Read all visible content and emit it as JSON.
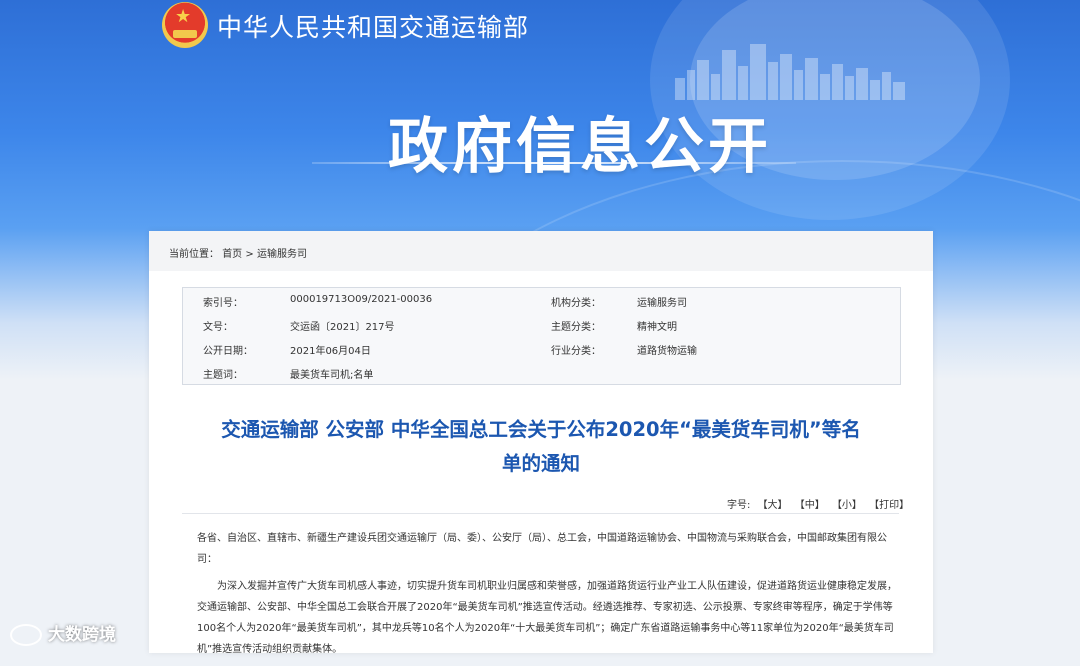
{
  "header": {
    "ministry_name": "中华人民共和国交通运输部",
    "page_title": "政府信息公开"
  },
  "breadcrumb": {
    "prefix": "当前位置：",
    "home": "首页",
    "separator": ">",
    "current": "运输服务司"
  },
  "meta": {
    "index_label": "索引号：",
    "index_value": "000019713O09/2021-00036",
    "org_label": "机构分类：",
    "org_value": "运输服务司",
    "docno_label": "文号：",
    "docno_value": "交运函〔2021〕217号",
    "topic_label": "主题分类：",
    "topic_value": "精神文明",
    "date_label": "公开日期：",
    "date_value": "2021年06月04日",
    "industry_label": "行业分类：",
    "industry_value": "道路货物运输",
    "keywords_label": "主题词：",
    "keywords_value": "最美货车司机;名单"
  },
  "document": {
    "title_line1": "交通运输部 公安部 中华全国总工会关于公布2020年“最美货车司机”等名",
    "title_line2": "单的通知",
    "font_label": "字号:",
    "font_large": "【大】",
    "font_medium": "【中】",
    "font_small": "【小】",
    "print": "【打印】",
    "salutation": "各省、自治区、直辖市、新疆生产建设兵团交通运输厅（局、委）、公安厅（局）、总工会，中国道路运输协会、中国物流与采购联合会，中国邮政集团有限公司：",
    "paragraph1": "为深入发掘并宣传广大货车司机感人事迹，切实提升货车司机职业归属感和荣誉感，加强道路货运行业产业工人队伍建设，促进道路货运业健康稳定发展，交通运输部、公安部、中华全国总工会联合开展了2020年“最美货车司机”推选宣传活动。经遴选推荐、专家初选、公示投票、专家终审等程序，确定于学伟等100名个人为2020年“最美货车司机”，其中龙兵等10名个人为2020年“十大最美货车司机”；确定广东省道路运输事务中心等11家单位为2020年“最美货车司机”推选宣传活动组织贡献集体。"
  },
  "watermark": {
    "text": "大数跨境"
  }
}
